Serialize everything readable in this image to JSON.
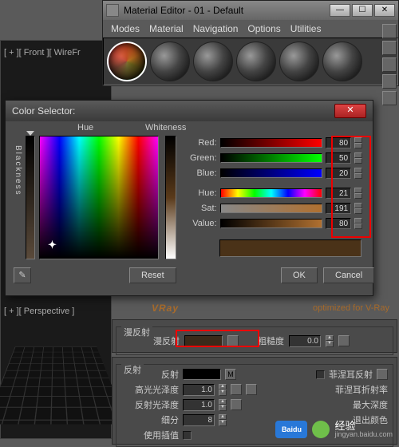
{
  "viewport": {
    "front_label": "[ + ][ Front ][ WireFr",
    "persp_label": "[ + ][ Perspective ]"
  },
  "material_editor": {
    "title": "Material Editor - 01 - Default",
    "menu": [
      "Modes",
      "Material",
      "Navigation",
      "Options",
      "Utilities"
    ]
  },
  "vray": {
    "logo_text": "VRay",
    "optimized": "optimized for V-Ray"
  },
  "diffuse_rollout": {
    "group": "漫反射",
    "diffuse_label": "漫反射",
    "rough_label": "粗糙度",
    "rough_value": "0.0"
  },
  "reflect_rollout": {
    "group": "反射",
    "reflect_label": "反射",
    "mbtn": "M",
    "gloss_hilite": "高光光泽度",
    "gloss_hilite_val": "1.0",
    "gloss_reflect": "反射光泽度",
    "gloss_reflect_val": "1.0",
    "subdiv": "细分",
    "subdiv_val": "8",
    "use_interp": "使用插值",
    "fresnel": "菲涅耳反射",
    "fresnel_ior": "菲涅耳折射率",
    "max_depth": "最大深度",
    "exit_color": "退出颜色"
  },
  "color_selector": {
    "title": "Color Selector:",
    "hue": "Hue",
    "whiteness": "Whiteness",
    "blackness": "Blackness",
    "rows": {
      "red": {
        "label": "Red:",
        "value": "80"
      },
      "green": {
        "label": "Green:",
        "value": "50"
      },
      "blue": {
        "label": "Blue:",
        "value": "20"
      },
      "hue": {
        "label": "Hue:",
        "value": "21"
      },
      "sat": {
        "label": "Sat:",
        "value": "191"
      },
      "value": {
        "label": "Value:",
        "value": "80"
      }
    },
    "reset": "Reset",
    "ok": "OK",
    "cancel": "Cancel",
    "close_x": "✕"
  },
  "watermark": {
    "brand": "Baidu",
    "sub": "经验",
    "url": "jingyan.baidu.com"
  }
}
